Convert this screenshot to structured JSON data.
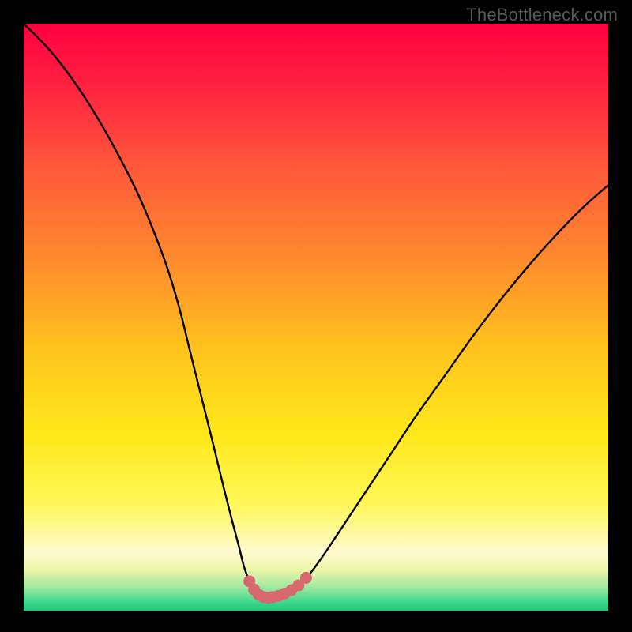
{
  "watermark": {
    "text": "TheBottleneck.com"
  },
  "colors": {
    "frame": "#000000",
    "curve_stroke": "#000000",
    "marker_fill": "#d86a6f",
    "gradient_stops": [
      {
        "offset": 0.0,
        "color": "#ff0040"
      },
      {
        "offset": 0.1,
        "color": "#ff2040"
      },
      {
        "offset": 0.25,
        "color": "#ff5a3a"
      },
      {
        "offset": 0.4,
        "color": "#ff8a2e"
      },
      {
        "offset": 0.55,
        "color": "#ffc21e"
      },
      {
        "offset": 0.7,
        "color": "#ffe81a"
      },
      {
        "offset": 0.82,
        "color": "#fff85a"
      },
      {
        "offset": 0.9,
        "color": "#fffad0"
      },
      {
        "offset": 0.93,
        "color": "#ecf7a8"
      },
      {
        "offset": 0.96,
        "color": "#a0e8a0"
      },
      {
        "offset": 0.985,
        "color": "#3fd98a"
      },
      {
        "offset": 1.0,
        "color": "#18c978"
      }
    ]
  },
  "chart_data": {
    "type": "line",
    "title": "",
    "xlabel": "",
    "ylabel": "",
    "xlim": [
      0,
      100
    ],
    "ylim": [
      0,
      100
    ],
    "series": [
      {
        "name": "bottleneck-curve",
        "x": [
          0,
          4,
          8,
          12,
          16,
          20,
          24,
          26.5,
          28.5,
          30.5,
          32.5,
          34.2,
          35.6,
          36.8,
          37.6,
          38.4,
          39.1,
          39.7,
          40.2,
          40.8,
          41.4,
          42.2,
          43.2,
          44.4,
          45.6,
          46.8,
          48.0,
          49.2,
          50.4,
          52.0,
          55.0,
          59.0,
          63.0,
          67.0,
          72.0,
          77.0,
          82.0,
          87.0,
          92.0,
          96.0,
          100.0
        ],
        "values": [
          100,
          96,
          91,
          85,
          78,
          70,
          60,
          52,
          44,
          36,
          28,
          21,
          15.5,
          11,
          7.8,
          5.5,
          4.0,
          3.0,
          2.5,
          2.3,
          2.3,
          2.4,
          2.6,
          2.9,
          3.4,
          4.2,
          5.2,
          6.6,
          8.2,
          10.5,
          15.0,
          21.0,
          27.0,
          33.0,
          40.0,
          47.0,
          53.5,
          59.5,
          65.0,
          69.0,
          72.5
        ]
      }
    ],
    "markers": {
      "name": "minimum-range-markers",
      "x": [
        38.6,
        39.4,
        40.2,
        41.0,
        41.8,
        42.6,
        43.6,
        44.6,
        45.8,
        47.0,
        48.3
      ],
      "values": [
        5.0,
        3.6,
        2.7,
        2.3,
        2.2,
        2.3,
        2.5,
        2.9,
        3.5,
        4.3,
        5.6
      ]
    }
  }
}
